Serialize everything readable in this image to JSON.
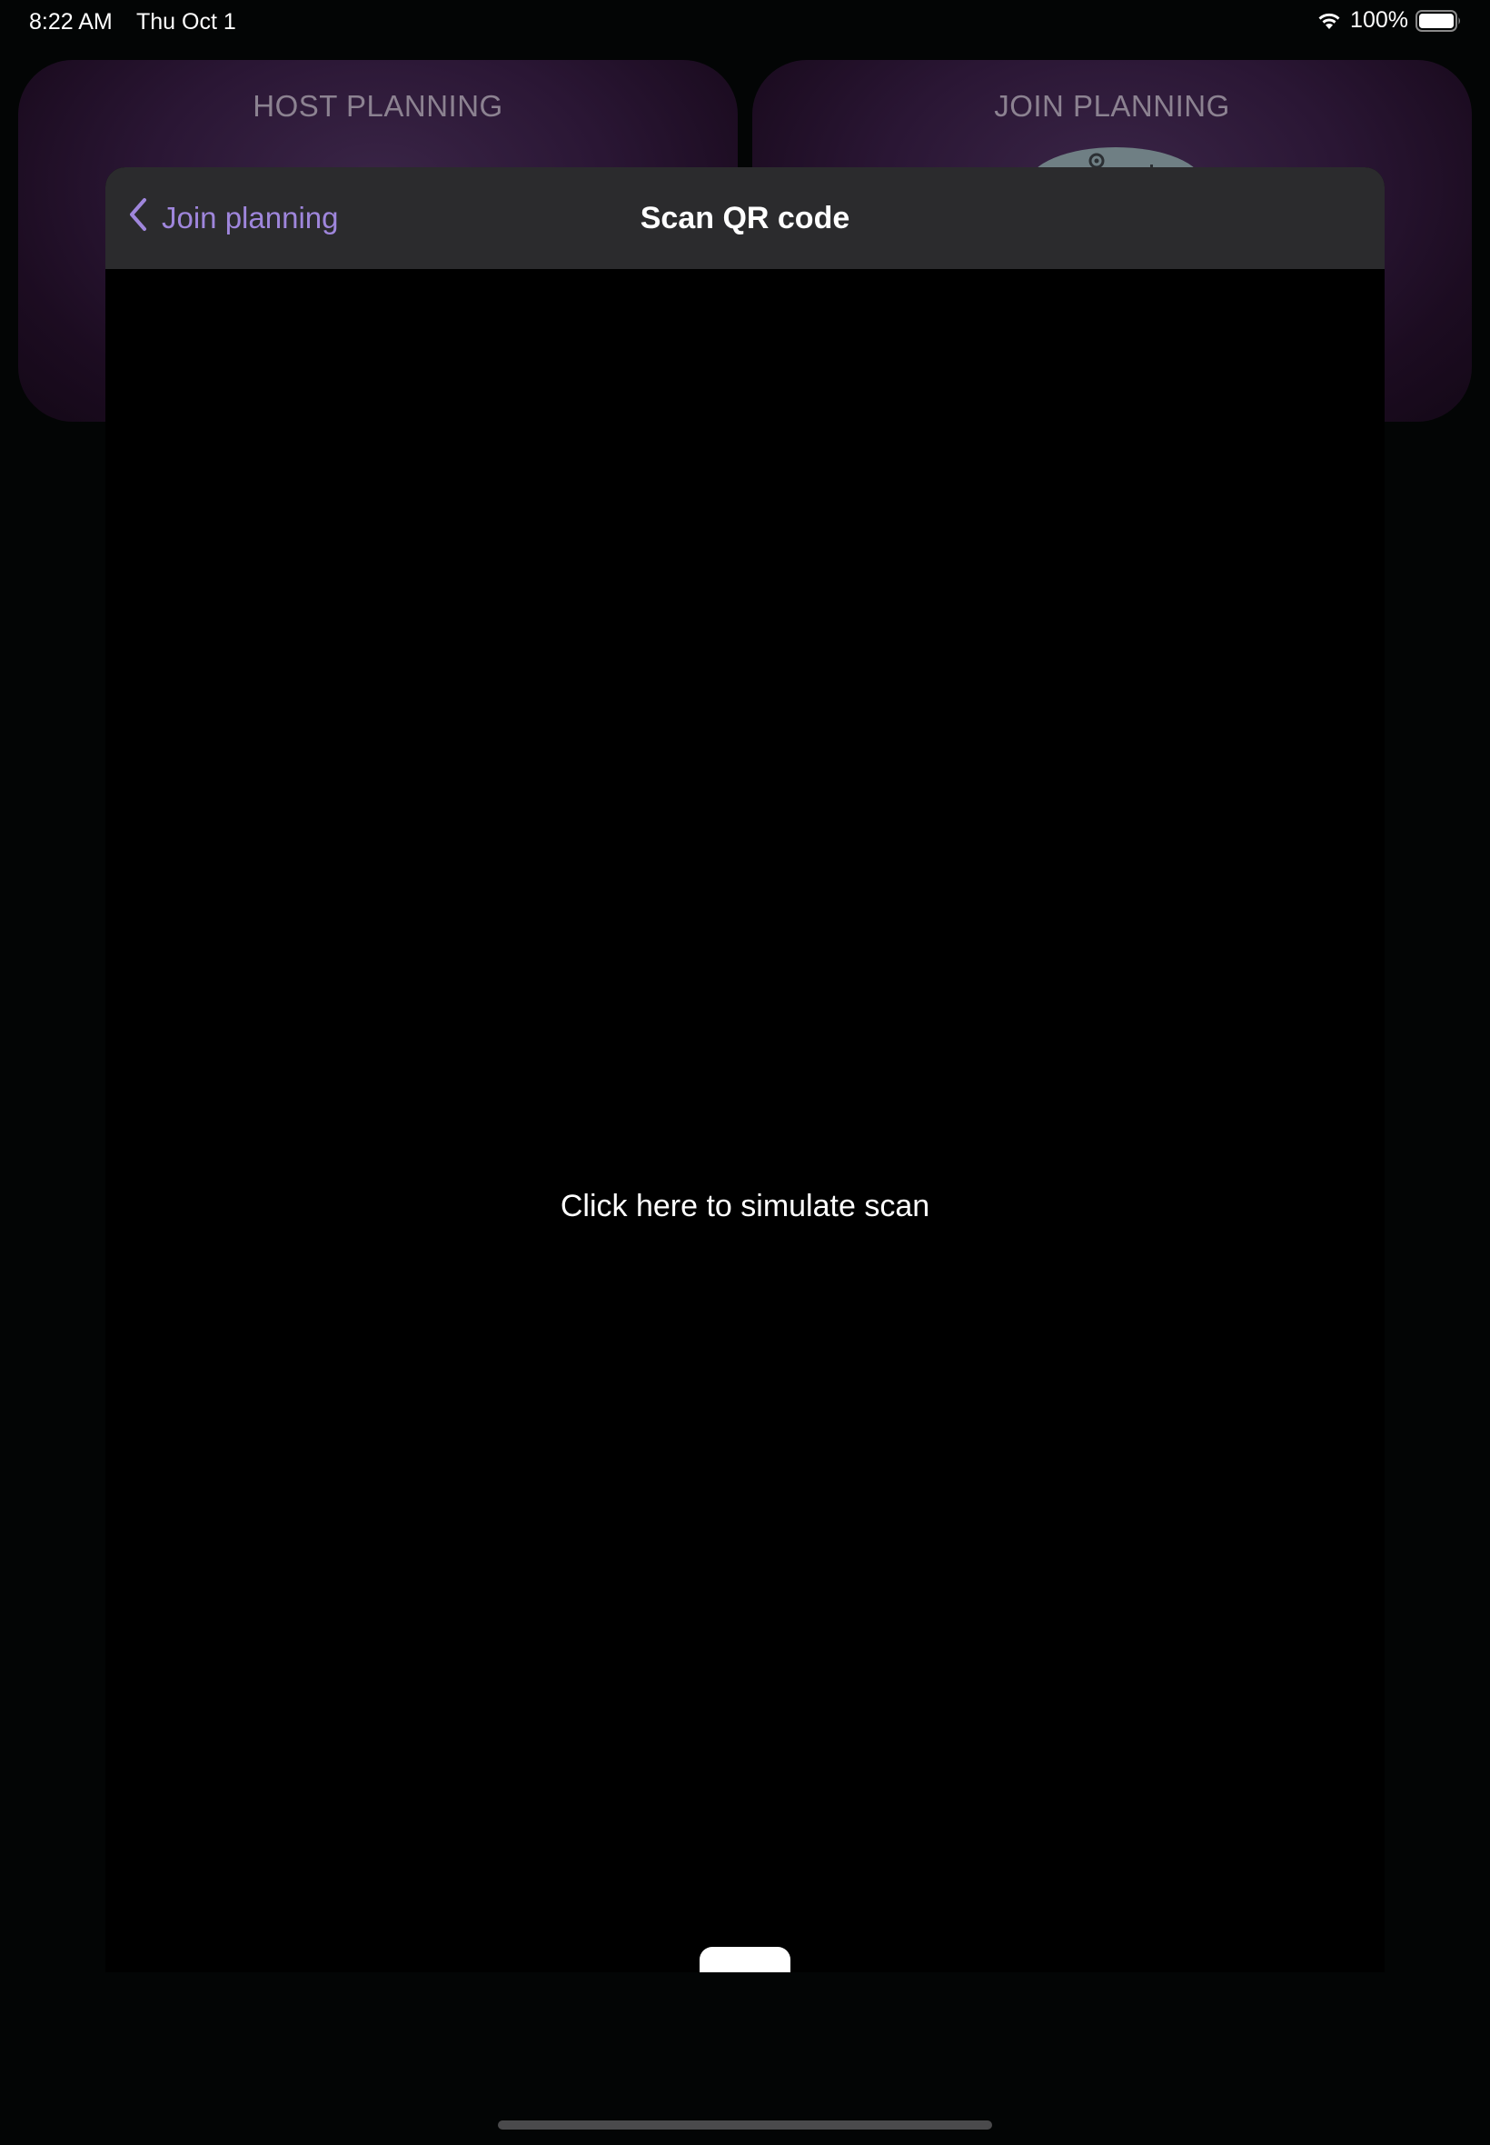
{
  "status_bar": {
    "time": "8:22 AM",
    "date": "Thu Oct 1",
    "battery_percent": "100%",
    "wifi_icon": "wifi-icon",
    "battery_icon": "battery-icon"
  },
  "background": {
    "cards": [
      {
        "title": "HOST PLANNING"
      },
      {
        "title": "JOIN PLANNING"
      }
    ]
  },
  "modal": {
    "nav": {
      "back_label": "Join planning",
      "back_icon": "chevron-left-icon",
      "title": "Scan QR code"
    },
    "scan_area": {
      "simulate_text": "Click here to simulate scan"
    },
    "flash_button": {
      "icon": "flash-off-icon"
    }
  },
  "colors": {
    "accent": "#9f86dc",
    "nav_background": "#2b2b2d",
    "flash_icon": "#1a82ff",
    "card_title": "#8c8291"
  }
}
